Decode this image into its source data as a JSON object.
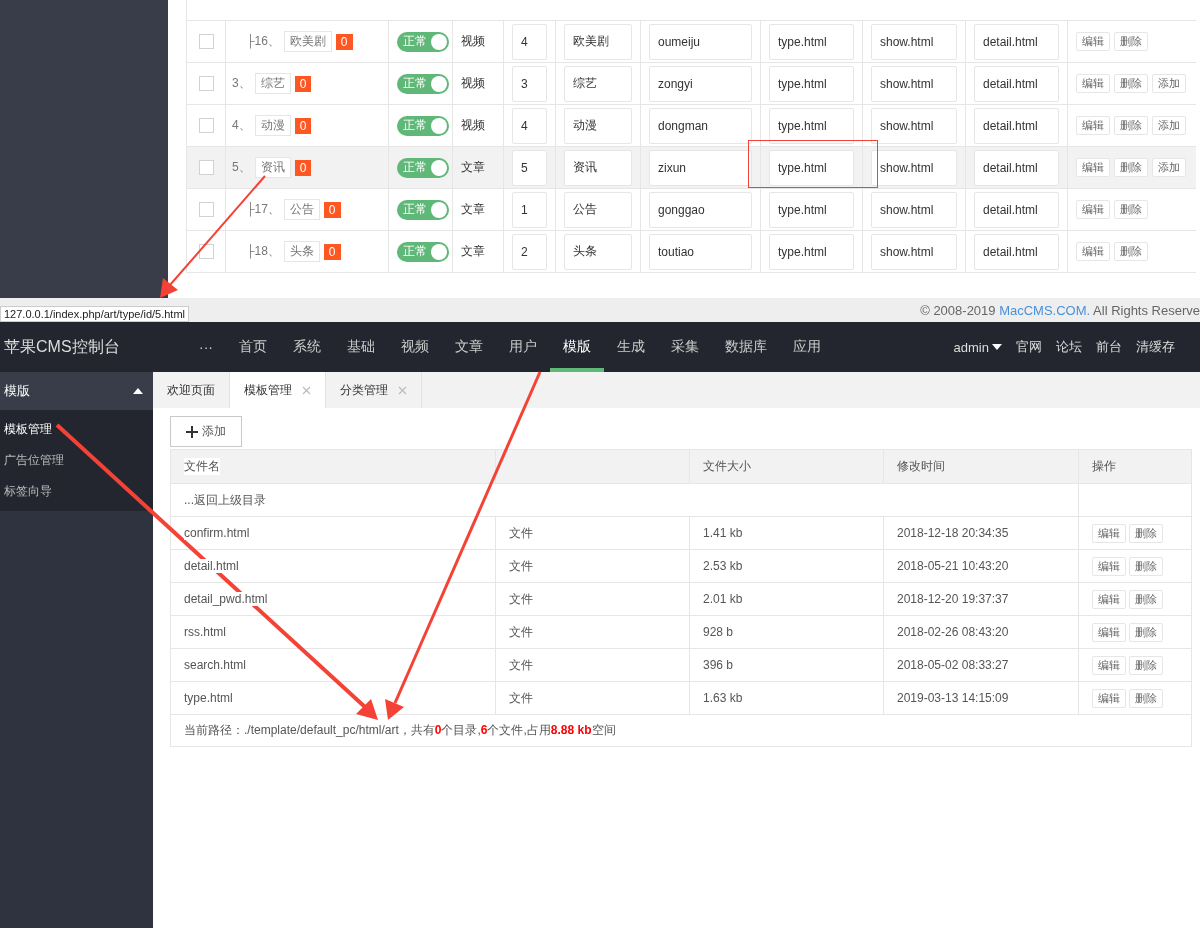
{
  "top_table": {
    "rows_continued": [
      {
        "prefix": "├16、",
        "name": "欧美剧",
        "count": "0",
        "status": "正常",
        "on": true,
        "model": "视频",
        "sort": "4",
        "name_field": "欧美剧",
        "en": "oumeiju",
        "type_tpl": "type.html",
        "show_tpl": "show.html",
        "detail_tpl": "detail.html",
        "actions": [
          "编辑",
          "删除"
        ],
        "checked": false,
        "highlighted": false
      }
    ],
    "rows": [
      {
        "prefix": "3、",
        "name": "综艺",
        "count": "0",
        "status": "正常",
        "on": true,
        "model": "视频",
        "sort": "3",
        "name_field": "综艺",
        "en": "zongyi",
        "type_tpl": "type.html",
        "show_tpl": "show.html",
        "detail_tpl": "detail.html",
        "actions": [
          "编辑",
          "删除",
          "添加"
        ],
        "checked": false,
        "highlighted": false
      },
      {
        "prefix": "4、",
        "name": "动漫",
        "count": "0",
        "status": "正常",
        "on": true,
        "model": "视频",
        "sort": "4",
        "name_field": "动漫",
        "en": "dongman",
        "type_tpl": "type.html",
        "show_tpl": "show.html",
        "detail_tpl": "detail.html",
        "actions": [
          "编辑",
          "删除",
          "添加"
        ],
        "checked": false,
        "highlighted": false
      },
      {
        "prefix": "5、",
        "name": "资讯",
        "count": "0",
        "status": "正常",
        "on": true,
        "model": "文章",
        "sort": "5",
        "name_field": "资讯",
        "en": "zixun",
        "type_tpl": "type.html",
        "show_tpl": "show.html",
        "detail_tpl": "detail.html",
        "actions": [
          "编辑",
          "删除",
          "添加"
        ],
        "checked": false,
        "highlighted": true,
        "children": [
          {
            "prefix": "├17、",
            "name": "公告",
            "count": "0",
            "status": "正常",
            "on": true,
            "model": "文章",
            "sort": "1",
            "name_field": "公告",
            "en": "gonggao",
            "type_tpl": "type.html",
            "show_tpl": "show.html",
            "detail_tpl": "detail.html",
            "actions": [
              "编辑",
              "删除"
            ],
            "checked": false,
            "highlighted": false
          },
          {
            "prefix": "├18、",
            "name": "头条",
            "count": "0",
            "status": "正常",
            "on": true,
            "model": "文章",
            "sort": "2",
            "name_field": "头条",
            "en": "toutiao",
            "type_tpl": "type.html",
            "show_tpl": "show.html",
            "detail_tpl": "detail.html",
            "actions": [
              "编辑",
              "删除"
            ],
            "checked": false,
            "highlighted": false
          }
        ]
      }
    ]
  },
  "status_url": "127.0.0.1/index.php/art/type/id/5.html",
  "copyright": {
    "prefix": "© 2008-2019 ",
    "link": "MacCMS.COM.",
    "suffix": " All Rights Reserve"
  },
  "header": {
    "logo": "苹果CMS控制台",
    "nav": [
      {
        "label": "···",
        "selected": false
      },
      {
        "label": "首页",
        "selected": false
      },
      {
        "label": "系统",
        "selected": false
      },
      {
        "label": "基础",
        "selected": false
      },
      {
        "label": "视频",
        "selected": false
      },
      {
        "label": "文章",
        "selected": false
      },
      {
        "label": "用户",
        "selected": false
      },
      {
        "label": "模版",
        "selected": true
      },
      {
        "label": "生成",
        "selected": false
      },
      {
        "label": "采集",
        "selected": false
      },
      {
        "label": "数据库",
        "selected": false
      },
      {
        "label": "应用",
        "selected": false
      }
    ],
    "user": "admin",
    "links": [
      "官网",
      "论坛",
      "前台",
      "清缓存"
    ]
  },
  "sidebar": {
    "group": "模版",
    "expanded": true,
    "items": [
      {
        "label": "模板管理",
        "selected": true
      },
      {
        "label": "广告位管理",
        "selected": false
      },
      {
        "label": "标签向导",
        "selected": false
      }
    ]
  },
  "tabs": [
    {
      "label": "欢迎页面",
      "selected": false,
      "closable": false
    },
    {
      "label": "模板管理",
      "selected": true,
      "closable": true
    },
    {
      "label": "分类管理",
      "selected": false,
      "closable": true
    }
  ],
  "add_button": "添加",
  "file_table": {
    "columns": [
      "文件名",
      "",
      "文件大小",
      "修改时间",
      "操作"
    ],
    "back_row": "...返回上级目录",
    "rows": [
      {
        "name": "confirm.html",
        "type": "文件",
        "size": "1.41 kb",
        "time": "2018-12-18 20:34:35",
        "actions": [
          "编辑",
          "删除"
        ]
      },
      {
        "name": "detail.html",
        "type": "文件",
        "size": "2.53 kb",
        "time": "2018-05-21 10:43:20",
        "actions": [
          "编辑",
          "删除"
        ]
      },
      {
        "name": "detail_pwd.html",
        "type": "文件",
        "size": "2.01 kb",
        "time": "2018-12-20 19:37:37",
        "actions": [
          "编辑",
          "删除"
        ]
      },
      {
        "name": "rss.html",
        "type": "文件",
        "size": "928 b",
        "time": "2018-02-26 08:43:20",
        "actions": [
          "编辑",
          "删除"
        ]
      },
      {
        "name": "search.html",
        "type": "文件",
        "size": "396 b",
        "time": "2018-05-02 08:33:27",
        "actions": [
          "编辑",
          "删除"
        ]
      },
      {
        "name": "type.html",
        "type": "文件",
        "size": "1.63 kb",
        "time": "2019-03-13 14:15:09",
        "actions": [
          "编辑",
          "删除"
        ]
      }
    ],
    "summary": "当前路径：./template/default_pc/html/art，共有**0**个目录,**6**个文件,占用**8.88 kb**空间"
  }
}
